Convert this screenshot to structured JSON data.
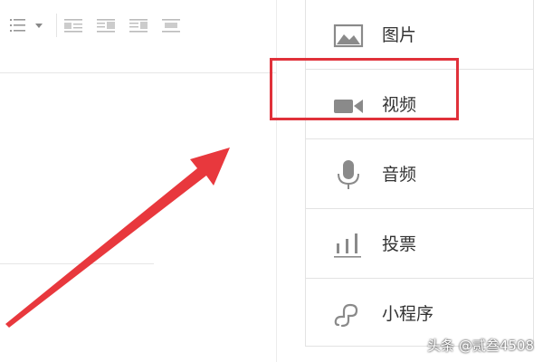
{
  "toolbar": {
    "icons": [
      "list-dropdown-icon",
      "align-left-icon",
      "align-center-icon",
      "align-right-icon",
      "align-justify-icon"
    ]
  },
  "insert_panel": {
    "items": [
      {
        "label": "图片",
        "icon": "image-icon"
      },
      {
        "label": "视频",
        "icon": "video-camera-icon"
      },
      {
        "label": "音频",
        "icon": "microphone-icon"
      },
      {
        "label": "投票",
        "icon": "bar-chart-icon"
      },
      {
        "label": "小程序",
        "icon": "mini-program-icon"
      }
    ],
    "highlighted_item": "视频"
  },
  "annotation": {
    "arrow_color": "#e8383d",
    "box_color": "#e0313a"
  },
  "watermark": {
    "text": "头条 @贰叁4508"
  }
}
